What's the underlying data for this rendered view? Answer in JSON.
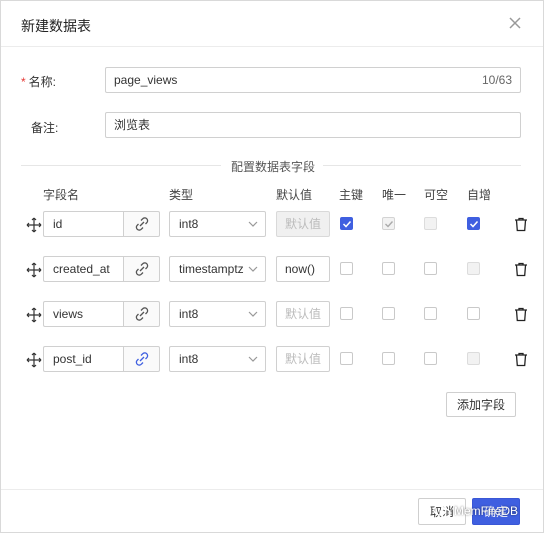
{
  "dialog": {
    "title": "新建数据表",
    "close_icon": "close-icon"
  },
  "form": {
    "name_label": "名称:",
    "name_required_mark": "*",
    "name_value": "page_views",
    "name_counter": "10/63",
    "remark_label": "备注:",
    "remark_value": "浏览表"
  },
  "fields_section": {
    "divider_title": "配置数据表字段",
    "headers": {
      "field_name": "字段名",
      "type": "类型",
      "default": "默认值",
      "primary_key": "主键",
      "unique": "唯一",
      "nullable": "可空",
      "auto_increment": "自增"
    },
    "default_placeholder": "默认值",
    "rows": [
      {
        "name": "id",
        "type": "int8",
        "default": "",
        "default_state": "disabled",
        "link_active": false,
        "primary_key": "checked",
        "unique": "checked-disabled",
        "nullable": "disabled",
        "auto_increment": "checked"
      },
      {
        "name": "created_at",
        "type": "timestamptz",
        "default": "now()",
        "default_state": "filled",
        "link_active": false,
        "primary_key": "unchecked",
        "unique": "unchecked",
        "nullable": "unchecked",
        "auto_increment": "disabled"
      },
      {
        "name": "views",
        "type": "int8",
        "default": "",
        "default_state": "placeholder",
        "link_active": false,
        "primary_key": "unchecked",
        "unique": "unchecked",
        "nullable": "unchecked",
        "auto_increment": "unchecked"
      },
      {
        "name": "post_id",
        "type": "int8",
        "default": "",
        "default_state": "placeholder",
        "link_active": true,
        "primary_key": "unchecked",
        "unique": "unchecked",
        "nullable": "unchecked",
        "auto_increment": "disabled"
      }
    ],
    "add_field_label": "添加字段"
  },
  "footer": {
    "cancel_label": "取消",
    "confirm_label": "确定"
  },
  "watermark": {
    "text": "MemFireDB"
  },
  "colors": {
    "accent": "#3f5fe0",
    "required": "#e53935",
    "link_active": "#3f5fe0"
  }
}
